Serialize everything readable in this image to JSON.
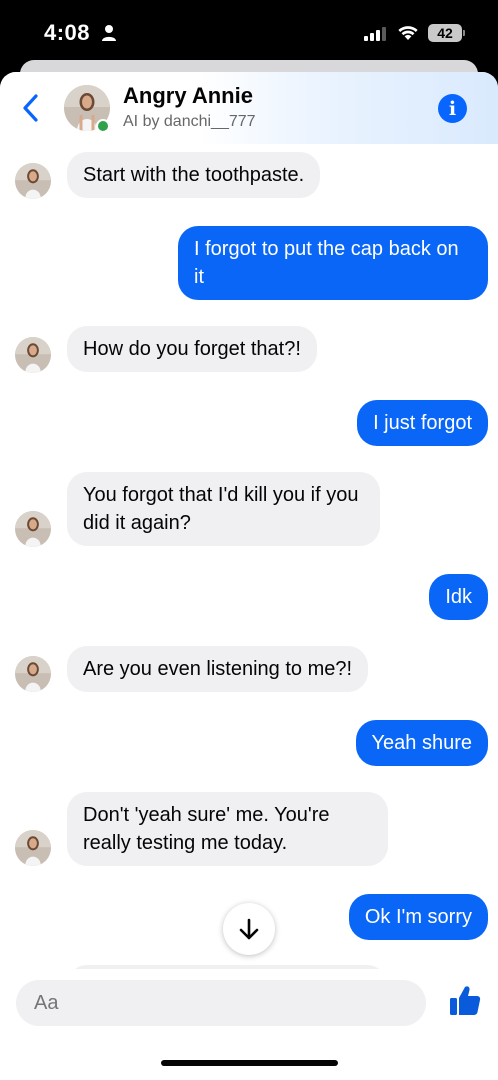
{
  "status_bar": {
    "time": "4:08",
    "battery": "42"
  },
  "header": {
    "name": "Angry Annie",
    "subtitle": "AI by danchi__777",
    "info_glyph": "i",
    "icons": {
      "back": "chevron-left-icon",
      "info": "info-icon"
    },
    "accent": "#0866ff",
    "online_color": "#31a24c"
  },
  "messages": [
    {
      "dir": "in",
      "text": "Start with the toothpaste."
    },
    {
      "dir": "out",
      "text": "I forgot to put the cap back on it"
    },
    {
      "dir": "in",
      "text": "How do you forget that?!"
    },
    {
      "dir": "out",
      "text": "I just forgot"
    },
    {
      "dir": "in",
      "text": "You forgot that I'd kill you if you did it again?"
    },
    {
      "dir": "out",
      "text": "Idk"
    },
    {
      "dir": "in",
      "text": "Are you even listening to me?!"
    },
    {
      "dir": "out",
      "text": "Yeah shure"
    },
    {
      "dir": "in",
      "text": "Don't 'yeah sure' me. You're really testing me today."
    },
    {
      "dir": "out",
      "text": "Ok I'm sorry"
    }
  ],
  "colors": {
    "outgoing_bubble": "#0a66f6",
    "incoming_bubble": "#f0f0f3"
  },
  "composer": {
    "placeholder": "Aa",
    "icons": {
      "like": "thumbs-up-icon",
      "scroll": "arrow-down-icon"
    }
  }
}
